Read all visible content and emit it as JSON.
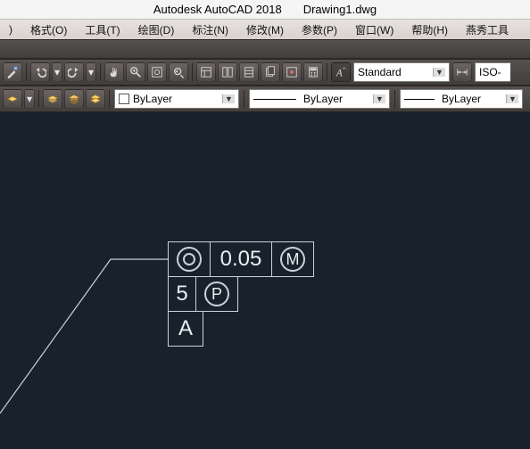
{
  "title": {
    "app": "Autodesk AutoCAD 2018",
    "doc": "Drawing1.dwg"
  },
  "menu": {
    "truncated": ")",
    "format": "格式(O)",
    "tools": "工具(T)",
    "draw": "绘图(D)",
    "dim": "标注(N)",
    "modify": "修改(M)",
    "param": "参数(P)",
    "window": "窗口(W)",
    "help": "帮助(H)",
    "yanxiu": "燕秀工具"
  },
  "style_dd": {
    "text_style": "Standard",
    "dim_style": "ISO-"
  },
  "layer_dd": {
    "color": "ByLayer",
    "linetype": "ByLayer",
    "lineweight": "ByLayer"
  },
  "gdt": {
    "sym": "◎",
    "tol": "0.05",
    "mod1": "M",
    "datum1_num": "5",
    "datum1_mod": "P",
    "datum2": "A"
  }
}
